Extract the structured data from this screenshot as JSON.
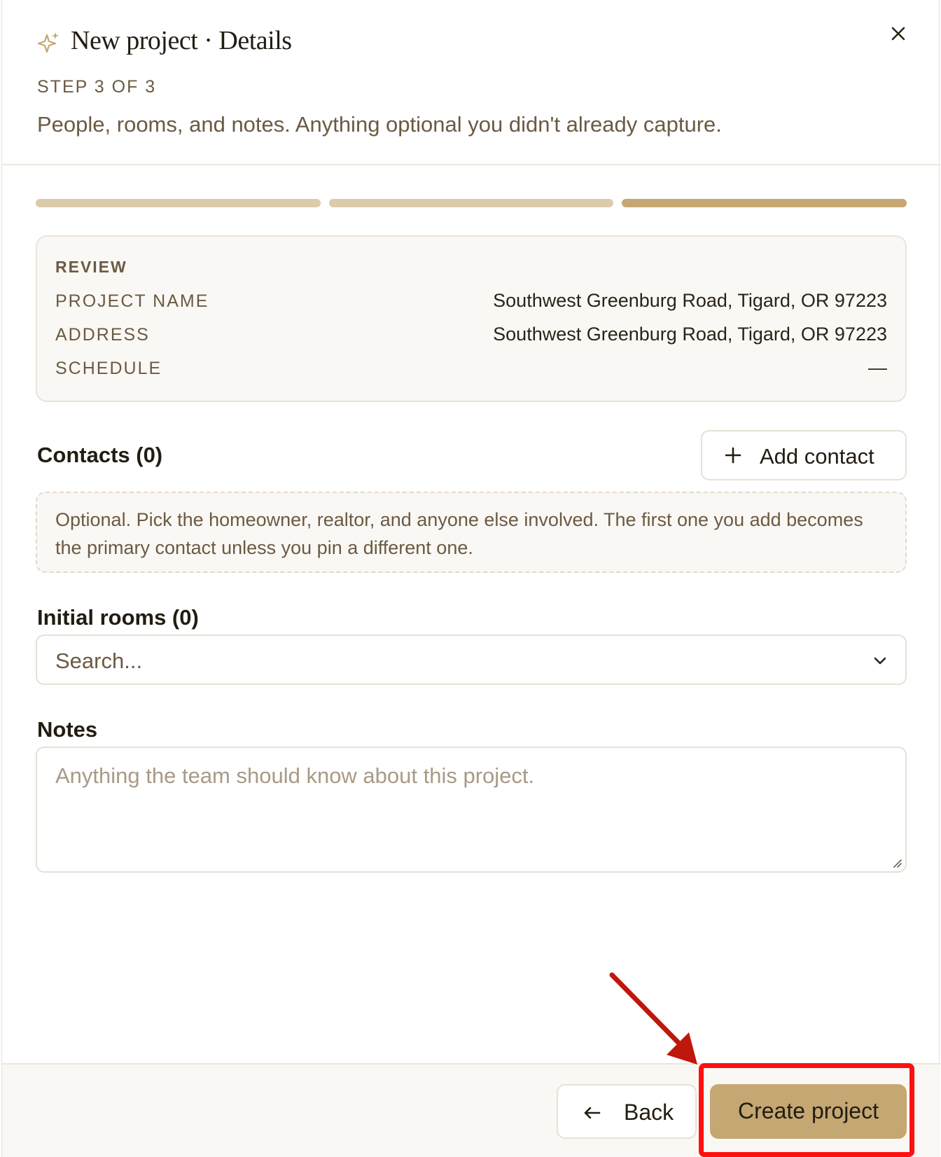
{
  "header": {
    "icon": "sparkle-icon",
    "title": "New project · Details",
    "step": "STEP 3 OF 3",
    "subtitle": "People, rooms, and notes. Anything optional you didn't already capture.",
    "close_icon": "close-icon"
  },
  "progress": {
    "total_steps": 3,
    "current_step": 3,
    "colors": {
      "completed": "#dccbab",
      "current": "#c4a772"
    }
  },
  "review": {
    "heading": "REVIEW",
    "rows": [
      {
        "label": "PROJECT NAME",
        "value": "Southwest Greenburg Road, Tigard, OR 97223"
      },
      {
        "label": "ADDRESS",
        "value": "Southwest Greenburg Road, Tigard, OR 97223"
      },
      {
        "label": "SCHEDULE",
        "value": "—"
      }
    ]
  },
  "contacts": {
    "title": "Contacts (0)",
    "add_label": "Add contact",
    "add_icon": "plus-icon",
    "hint": "Optional. Pick the homeowner, realtor, and anyone else involved. The first one you add becomes the primary contact unless you pin a different one."
  },
  "rooms": {
    "title": "Initial rooms (0)",
    "placeholder": "Search...",
    "icon": "chevron-down-icon"
  },
  "notes": {
    "title": "Notes",
    "placeholder": "Anything the team should know about this project."
  },
  "footer": {
    "back_label": "Back",
    "back_icon": "arrow-left-icon",
    "create_label": "Create project"
  },
  "colors": {
    "accent": "#c4a772",
    "annotation": "#ff0f0f",
    "muted_text": "#6b5a42"
  }
}
